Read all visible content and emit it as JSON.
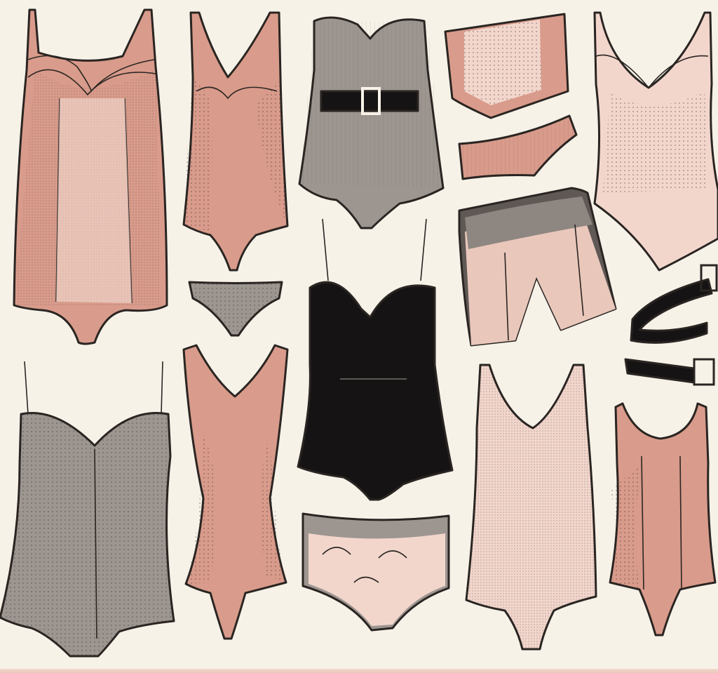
{
  "palette": {
    "background": "#f7f2e8",
    "rose": "#d99b8b",
    "blush": "#f2d6cc",
    "lace": "#f6e3da",
    "grey": "#9d9590",
    "charcoal": "#5f5855",
    "black": "#151313",
    "ink": "#2a2522"
  },
  "garments": [
    {
      "kind": "lace bodysuit",
      "color": "rose"
    },
    {
      "kind": "plunge bodysuit",
      "color": "rose"
    },
    {
      "kind": "belted corset bodysuit",
      "color": "grey"
    },
    {
      "kind": "waist cincher",
      "color": "rose"
    },
    {
      "kind": "brief",
      "color": "rose"
    },
    {
      "kind": "lace camisole bodysuit",
      "color": "blush"
    },
    {
      "kind": "lace thong",
      "color": "grey"
    },
    {
      "kind": "strappy bodysuit",
      "color": "black"
    },
    {
      "kind": "garter shorts",
      "color": "charcoal"
    },
    {
      "kind": "strap with buckle",
      "color": "black"
    },
    {
      "kind": "strap with buckle",
      "color": "black"
    },
    {
      "kind": "mesh bodysuit",
      "color": "grey"
    },
    {
      "kind": "racerback bodysuit",
      "color": "rose"
    },
    {
      "kind": "floral high-waist brief",
      "color": "grey"
    },
    {
      "kind": "textured bodysuit",
      "color": "blush"
    },
    {
      "kind": "paneled bodysuit",
      "color": "rose"
    }
  ]
}
